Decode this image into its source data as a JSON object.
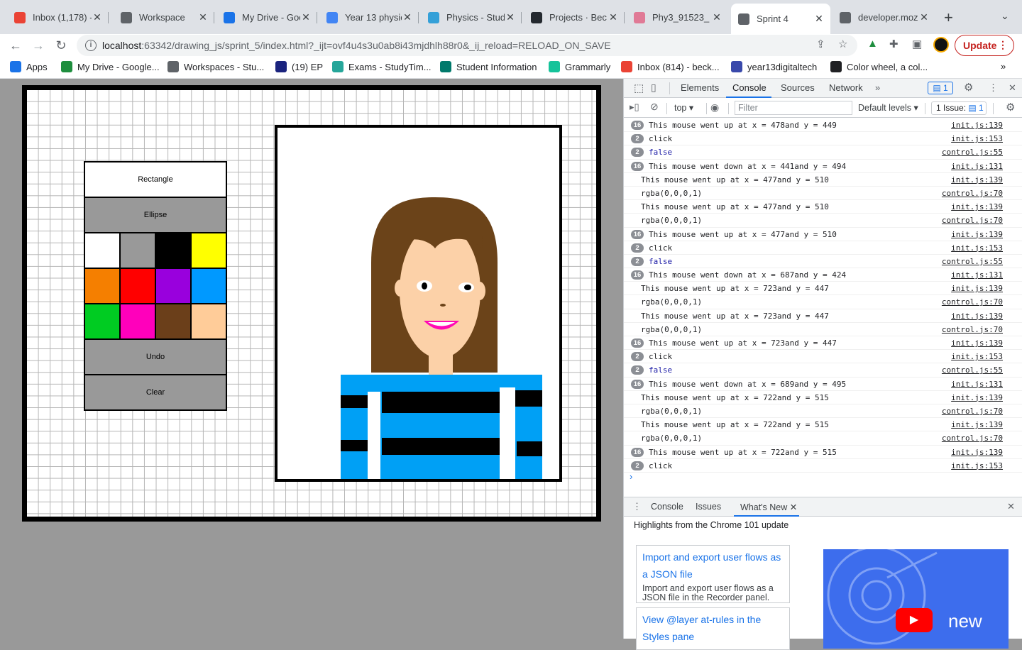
{
  "browser": {
    "tabs": [
      {
        "title": "Inbox (1,178) -",
        "icon": "gmail-icon",
        "color": "#ea4335"
      },
      {
        "title": "Workspace",
        "icon": "workspace-icon",
        "color": "#5f6368"
      },
      {
        "title": "My Drive - Goo",
        "icon": "drive-icon",
        "color": "#1a73e8"
      },
      {
        "title": "Year 13 physic",
        "icon": "docs-icon",
        "color": "#4285f4"
      },
      {
        "title": "Physics - Stud",
        "icon": "physics-icon",
        "color": "#34a0d8"
      },
      {
        "title": "Projects · Bec",
        "icon": "github-icon",
        "color": "#24292f"
      },
      {
        "title": "Phy3_91523_",
        "icon": "brain-icon",
        "color": "#e07a96"
      },
      {
        "title": "Sprint 4",
        "icon": "globe-icon",
        "color": "#5f6368"
      },
      {
        "title": "developer.moz",
        "icon": "globe-icon",
        "color": "#5f6368"
      }
    ],
    "active_tab_index": 7,
    "url": {
      "host": "localhost",
      "path": ":63342/drawing_js/sprint_5/index.html?_ijt=ovf4u4s3u0ab8i43mjdhlh88r0&_ij_reload=RELOAD_ON_SAVE"
    },
    "update_label": "Update",
    "bookmarks": [
      {
        "label": "Apps",
        "icon": "apps-grid-icon",
        "color": "#1a73e8"
      },
      {
        "label": "My Drive - Google...",
        "icon": "drive-icon",
        "color": "#1e8e3e"
      },
      {
        "label": "Workspaces - Stu...",
        "icon": "workspace-icon",
        "color": "#5f6368"
      },
      {
        "label": "(19) EP",
        "icon": "ep-icon",
        "color": "#1a237e"
      },
      {
        "label": "Exams - StudyTim...",
        "icon": "studytime-icon",
        "color": "#26a69a"
      },
      {
        "label": "Student Information",
        "icon": "pcs-icon",
        "color": "#00796b"
      },
      {
        "label": "Grammarly",
        "icon": "grammarly-icon",
        "color": "#15c39a"
      },
      {
        "label": "Inbox (814) - beck...",
        "icon": "gmail-icon",
        "color": "#ea4335"
      },
      {
        "label": "year13digitaltech",
        "icon": "classroom-icon",
        "color": "#3949ab"
      },
      {
        "label": "Color wheel, a col...",
        "icon": "colorwheel-icon",
        "color": "#202124"
      }
    ]
  },
  "drawing_app": {
    "buttons": {
      "rectangle": "Rectangle",
      "ellipse": "Ellipse",
      "undo": "Undo",
      "clear": "Clear"
    },
    "swatches": [
      "#ffffff",
      "#999999",
      "#000000",
      "#ffff00",
      "#f57f00",
      "#ff0000",
      "#9900dd",
      "#0099ff",
      "#00cc22",
      "#ff00bb",
      "#6b3f1a",
      "#ffcc99"
    ],
    "colors": {
      "hair": "#6b4319",
      "skin": "#fcd1a8",
      "shirt_blue": "#00a0f5",
      "stripe": "#000000",
      "mouth": "#ff0ab4"
    }
  },
  "devtools": {
    "tabs": [
      "Elements",
      "Console",
      "Sources",
      "Network"
    ],
    "active_tab": "Console",
    "issues_badge": "1",
    "context": "top",
    "filter_placeholder": "Filter",
    "levels": "Default levels",
    "issue_counter": "1 Issue:",
    "issue_counter_num": "1",
    "console": [
      {
        "count": "16",
        "text": "This mouse went up at x = 478and y = 449",
        "src": "init.js:139",
        "type": "log"
      },
      {
        "count": "2",
        "text": "click",
        "src": "init.js:153",
        "type": "log"
      },
      {
        "count": "2",
        "text": "false",
        "src": "control.js:55",
        "type": "bool"
      },
      {
        "count": "16",
        "text": "This mouse went down at x = 441and y = 494",
        "src": "init.js:131",
        "type": "log"
      },
      {
        "count": "",
        "text": "This mouse went up at x = 477and y = 510",
        "src": "init.js:139",
        "type": "log"
      },
      {
        "count": "",
        "text": "rgba(0,0,0,1)",
        "src": "control.js:70",
        "type": "log"
      },
      {
        "count": "",
        "text": "This mouse went up at x = 477and y = 510",
        "src": "init.js:139",
        "type": "log"
      },
      {
        "count": "",
        "text": "rgba(0,0,0,1)",
        "src": "control.js:70",
        "type": "log"
      },
      {
        "count": "16",
        "text": "This mouse went up at x = 477and y = 510",
        "src": "init.js:139",
        "type": "log"
      },
      {
        "count": "2",
        "text": "click",
        "src": "init.js:153",
        "type": "log"
      },
      {
        "count": "2",
        "text": "false",
        "src": "control.js:55",
        "type": "bool"
      },
      {
        "count": "16",
        "text": "This mouse went down at x = 687and y = 424",
        "src": "init.js:131",
        "type": "log"
      },
      {
        "count": "",
        "text": "This mouse went up at x = 723and y = 447",
        "src": "init.js:139",
        "type": "log"
      },
      {
        "count": "",
        "text": "rgba(0,0,0,1)",
        "src": "control.js:70",
        "type": "log"
      },
      {
        "count": "",
        "text": "This mouse went up at x = 723and y = 447",
        "src": "init.js:139",
        "type": "log"
      },
      {
        "count": "",
        "text": "rgba(0,0,0,1)",
        "src": "control.js:70",
        "type": "log"
      },
      {
        "count": "16",
        "text": "This mouse went up at x = 723and y = 447",
        "src": "init.js:139",
        "type": "log"
      },
      {
        "count": "2",
        "text": "click",
        "src": "init.js:153",
        "type": "log"
      },
      {
        "count": "2",
        "text": "false",
        "src": "control.js:55",
        "type": "bool"
      },
      {
        "count": "16",
        "text": "This mouse went down at x = 689and y = 495",
        "src": "init.js:131",
        "type": "log"
      },
      {
        "count": "",
        "text": "This mouse went up at x = 722and y = 515",
        "src": "init.js:139",
        "type": "log"
      },
      {
        "count": "",
        "text": "rgba(0,0,0,1)",
        "src": "control.js:70",
        "type": "log"
      },
      {
        "count": "",
        "text": "This mouse went up at x = 722and y = 515",
        "src": "init.js:139",
        "type": "log"
      },
      {
        "count": "",
        "text": "rgba(0,0,0,1)",
        "src": "control.js:70",
        "type": "log"
      },
      {
        "count": "16",
        "text": "This mouse went up at x = 722and y = 515",
        "src": "init.js:139",
        "type": "log"
      },
      {
        "count": "2",
        "text": "click",
        "src": "init.js:153",
        "type": "log"
      }
    ],
    "drawer": {
      "tabs": [
        "Console",
        "Issues",
        "What's New"
      ],
      "active_tab": "What's New",
      "heading": "Highlights from the Chrome 101 update",
      "cards": [
        {
          "title": "Import and export user flows as a JSON file",
          "desc": "Import and export user flows as a JSON file in the Recorder panel."
        },
        {
          "title": "View @layer at-rules in the Styles pane",
          "desc": ""
        }
      ],
      "promo_text": "new"
    }
  }
}
